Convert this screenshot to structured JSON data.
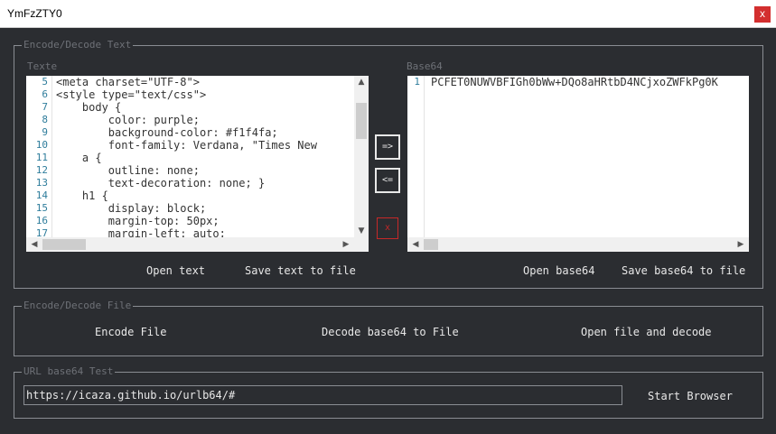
{
  "window": {
    "title": "YmFzZTY0",
    "close_label": "x"
  },
  "encode_text_group": {
    "legend": "Encode/Decode Text",
    "text_label": "Texte",
    "base64_label": "Base64",
    "text_editor": {
      "line_numbers": [
        "5",
        "6",
        "7",
        "8",
        "9",
        "10",
        "11",
        "12",
        "13",
        "14",
        "15",
        "16",
        "17"
      ],
      "lines": [
        "<meta charset=\"UTF-8\">",
        "<style type=\"text/css\">",
        "    body {",
        "        color: purple;",
        "        background-color: #f1f4fa;",
        "        font-family: Verdana, \"Times New",
        "    a {",
        "        outline: none;",
        "        text-decoration: none; }",
        "    h1 {",
        "        display: block;",
        "        margin-top: 50px;",
        "        margin-left: auto;"
      ]
    },
    "base64_editor": {
      "line_numbers": [
        "1"
      ],
      "lines": [
        "PCFET0NUWVBFIGh0bWw+DQo8aHRtbD4NCjxoZWFkPg0K"
      ]
    },
    "encode_button": "=>",
    "decode_button": "<=",
    "clear_button": "x",
    "open_text": "Open text",
    "save_text": "Save text to file",
    "open_base64": "Open base64",
    "save_base64": "Save base64 to file"
  },
  "encode_file_group": {
    "legend": "Encode/Decode File",
    "encode_file": "Encode File",
    "decode_file": "Decode base64 to File",
    "open_decode": "Open file and decode"
  },
  "url_group": {
    "legend": "URL base64 Test",
    "url_value": "https://icaza.github.io/urlb64/#",
    "start_browser": "Start Browser"
  },
  "icons": {
    "scroll_up": "chevron-up-icon",
    "scroll_down": "chevron-down-icon",
    "scroll_left": "chevron-left-icon",
    "scroll_right": "chevron-right-icon"
  }
}
